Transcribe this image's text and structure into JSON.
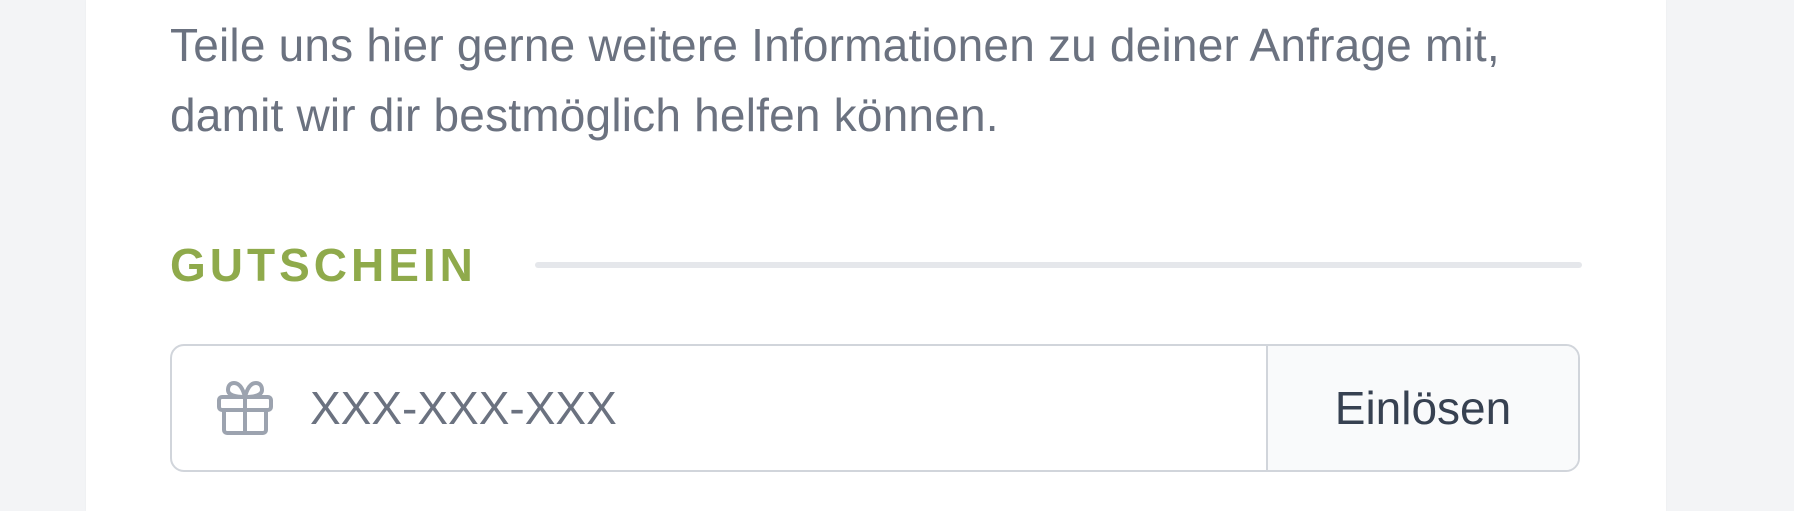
{
  "form": {
    "intro_text": "Teile uns hier gerne weitere Informationen zu deiner Anfrage mit, damit wir dir bestmöglich helfen können.",
    "voucher_section": {
      "title": "GUTSCHEIN",
      "title_color": "#8faa4b",
      "input_placeholder": "XXX-XXX-XXX",
      "input_value": "",
      "icon": "gift-icon",
      "redeem_label": "Einlösen"
    }
  }
}
